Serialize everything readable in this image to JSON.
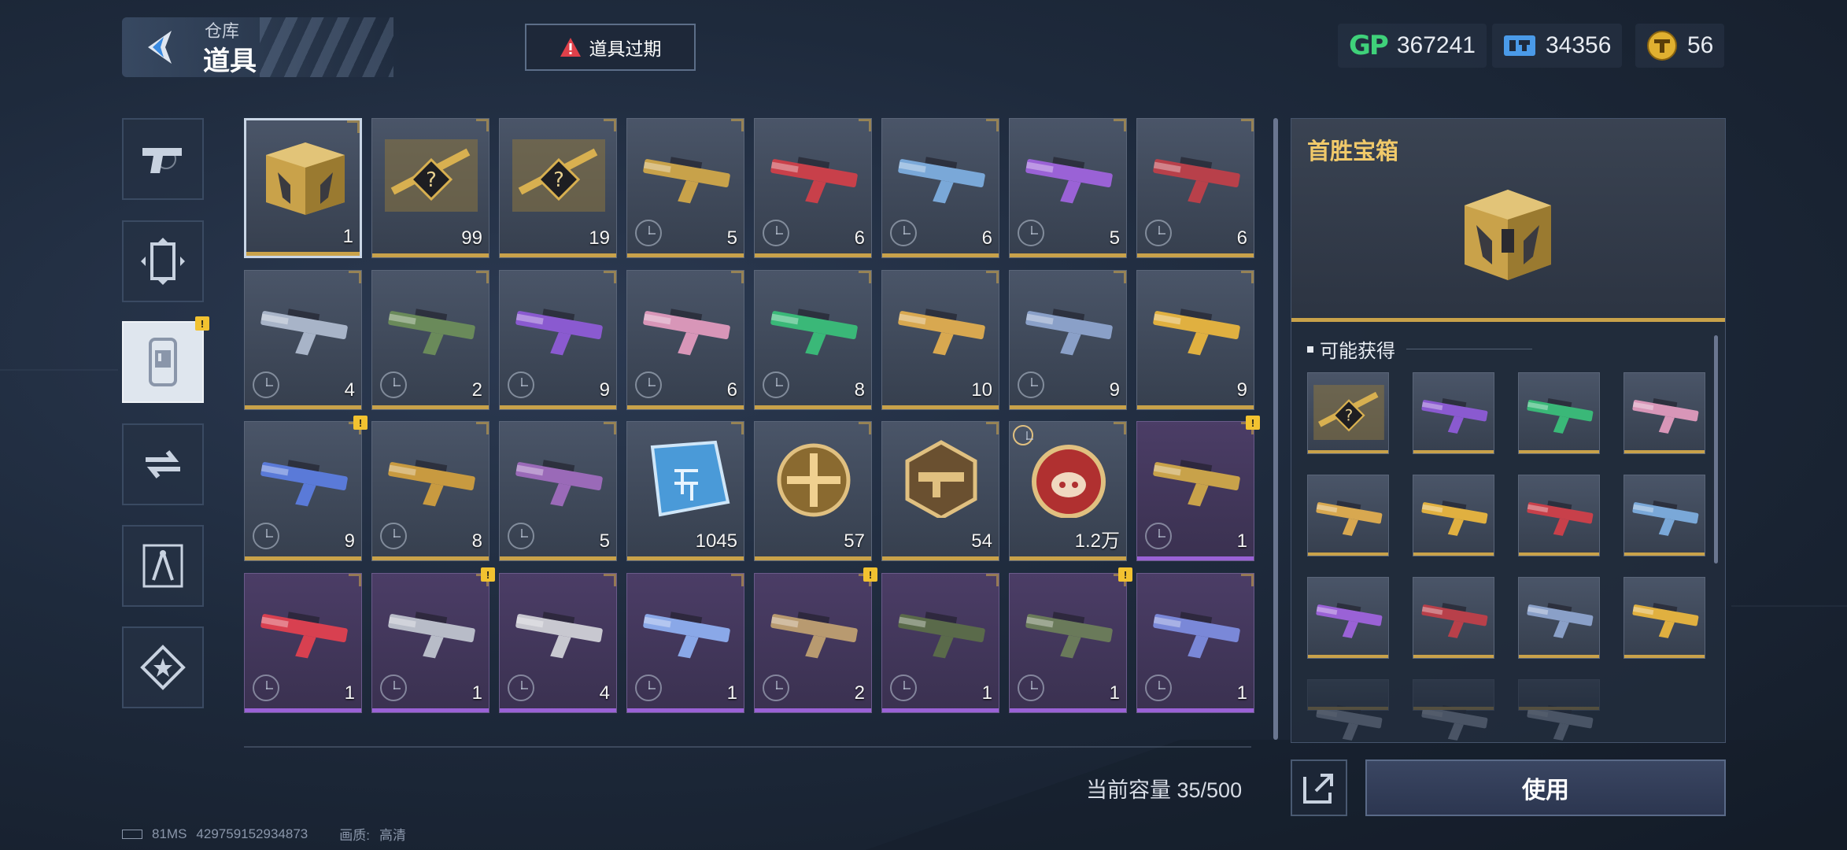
{
  "header": {
    "breadcrumb_parent": "仓库",
    "title": "道具",
    "expire_button_label": "道具过期"
  },
  "currencies": [
    {
      "icon": "gp-icon",
      "value": "367241"
    },
    {
      "icon": "ticket-icon",
      "value": "34356"
    },
    {
      "icon": "gold-coin-icon",
      "value": "56"
    }
  ],
  "sidebar": {
    "tabs": [
      {
        "icon": "pistol-icon"
      },
      {
        "icon": "frame-icon"
      },
      {
        "icon": "item-card-icon",
        "active": true,
        "badge": "!"
      },
      {
        "icon": "swap-icon"
      },
      {
        "icon": "blueprint-icon"
      },
      {
        "icon": "star-badge-icon"
      }
    ]
  },
  "grid": {
    "rows": [
      [
        {
          "qty": "1",
          "kind": "chest",
          "selected": true
        },
        {
          "qty": "99",
          "kind": "blueprint"
        },
        {
          "qty": "19",
          "kind": "blueprint"
        },
        {
          "qty": "5",
          "kind": "gun",
          "color": "#c8a24a",
          "clock": true
        },
        {
          "qty": "6",
          "kind": "gun",
          "color": "#c8404a",
          "clock": true
        },
        {
          "qty": "6",
          "kind": "gun",
          "color": "#7aa8d8",
          "clock": true
        },
        {
          "qty": "5",
          "kind": "gun",
          "color": "#9a62d6",
          "clock": true
        },
        {
          "qty": "6",
          "kind": "gun",
          "color": "#b8404a",
          "clock": true
        }
      ],
      [
        {
          "qty": "4",
          "kind": "gun",
          "color": "#a8b4c8",
          "clock": true
        },
        {
          "qty": "2",
          "kind": "gun",
          "color": "#6a8a5a",
          "clock": true
        },
        {
          "qty": "9",
          "kind": "gun",
          "color": "#8a5ad0",
          "clock": true
        },
        {
          "qty": "6",
          "kind": "gun",
          "color": "#d896b8",
          "clock": true
        },
        {
          "qty": "8",
          "kind": "gun",
          "color": "#3ab878",
          "clock": true
        },
        {
          "qty": "10",
          "kind": "gun",
          "color": "#d8a850",
          "clock": false
        },
        {
          "qty": "9",
          "kind": "gun",
          "color": "#8aa0c8",
          "clock": true
        },
        {
          "qty": "9",
          "kind": "gun",
          "color": "#e0b040",
          "clock": false
        }
      ],
      [
        {
          "qty": "9",
          "kind": "gun",
          "color": "#5a7ad8",
          "clock": true,
          "badge": true
        },
        {
          "qty": "8",
          "kind": "gun",
          "color": "#c89a40",
          "clock": true
        },
        {
          "qty": "5",
          "kind": "gun",
          "color": "#9a6ab8",
          "clock": true
        },
        {
          "qty": "1045",
          "kind": "chip"
        },
        {
          "qty": "57",
          "kind": "coin-cross"
        },
        {
          "qty": "54",
          "kind": "hex-gun"
        },
        {
          "qty": "1.2万",
          "kind": "pig-coin",
          "timer": true
        },
        {
          "qty": "1",
          "kind": "gun",
          "color": "#c8a24a",
          "clock": true,
          "purple": true,
          "badge": true
        }
      ],
      [
        {
          "qty": "1",
          "kind": "gun",
          "color": "#d84050",
          "clock": true,
          "purple": true
        },
        {
          "qty": "1",
          "kind": "gun",
          "color": "#b8bcc8",
          "clock": true,
          "purple": true,
          "badge": true
        },
        {
          "qty": "4",
          "kind": "gun",
          "color": "#c8c8d0",
          "clock": true,
          "purple": true
        },
        {
          "qty": "1",
          "kind": "gun",
          "color": "#8aa8e8",
          "clock": true,
          "purple": true
        },
        {
          "qty": "2",
          "kind": "gun",
          "color": "#b89a70",
          "clock": true,
          "purple": true,
          "badge": true
        },
        {
          "qty": "1",
          "kind": "gun",
          "color": "#5a6a4a",
          "clock": true,
          "purple": true
        },
        {
          "qty": "1",
          "kind": "gun",
          "color": "#6a7a5a",
          "clock": true,
          "purple": true,
          "badge": true
        },
        {
          "qty": "1",
          "kind": "gun",
          "color": "#7a88d8",
          "clock": true,
          "purple": true
        }
      ]
    ]
  },
  "capacity_text": "当前容量 35/500",
  "detail": {
    "title": "首胜宝箱",
    "possible_label": "可能获得",
    "rewards": [
      {
        "kind": "blueprint"
      },
      {
        "kind": "gun",
        "color": "#8a5ad0"
      },
      {
        "kind": "gun",
        "color": "#3ab878"
      },
      {
        "kind": "gun",
        "color": "#d896b8"
      },
      {
        "kind": "gun",
        "color": "#d8a850"
      },
      {
        "kind": "gun",
        "color": "#e0b040"
      },
      {
        "kind": "gun",
        "color": "#c8404a"
      },
      {
        "kind": "gun",
        "color": "#7aa8d8"
      },
      {
        "kind": "gun",
        "color": "#9a62d6"
      },
      {
        "kind": "gun",
        "color": "#b8404a"
      },
      {
        "kind": "gun",
        "color": "#8aa0c8"
      },
      {
        "kind": "gun",
        "color": "#e0b040"
      },
      {
        "kind": "gun",
        "color": "#a8b4c8",
        "faded": true
      },
      {
        "kind": "gun",
        "color": "#a8b4c8",
        "faded": true
      },
      {
        "kind": "gun",
        "color": "#a8b4c8",
        "faded": true
      }
    ]
  },
  "use_button_label": "使用",
  "status_bar": {
    "ping": "81MS",
    "uid": "429759152934873",
    "quality_label": "画质:",
    "quality_value": "高清"
  },
  "colors": {
    "accent_gold": "#c9a24a",
    "title_gold": "#f0c96a",
    "badge_yellow": "#f2c230",
    "purple_rarity": "#9a62d6"
  }
}
